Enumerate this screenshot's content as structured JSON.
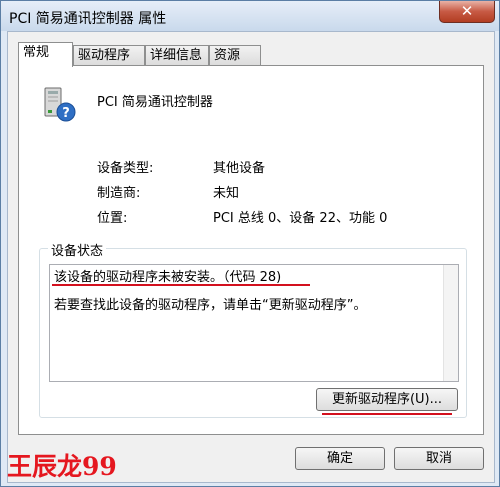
{
  "window": {
    "title": "PCI 简易通讯控制器 属性",
    "close_label": "✕"
  },
  "tabs": [
    {
      "label": "常规"
    },
    {
      "label": "驱动程序"
    },
    {
      "label": "详细信息"
    },
    {
      "label": "资源"
    }
  ],
  "device": {
    "icon": "device-question-icon",
    "name": "PCI 简易通讯控制器",
    "rows": [
      {
        "label": "设备类型:",
        "value": "其他设备"
      },
      {
        "label": "制造商:",
        "value": "未知"
      },
      {
        "label": "位置:",
        "value": "PCI 总线 0、设备 22、功能 0"
      }
    ]
  },
  "status": {
    "title": "设备状态",
    "line1": "该设备的驱动程序未被安装。（代码 28)",
    "line2": "若要查找此设备的驱动程序，请单击“更新驱动程序”。"
  },
  "buttons": {
    "update": "更新驱动程序(U)...",
    "ok": "确定",
    "cancel": "取消"
  },
  "watermark": "王辰龙99",
  "colors": {
    "annotation": "#d3101e"
  }
}
